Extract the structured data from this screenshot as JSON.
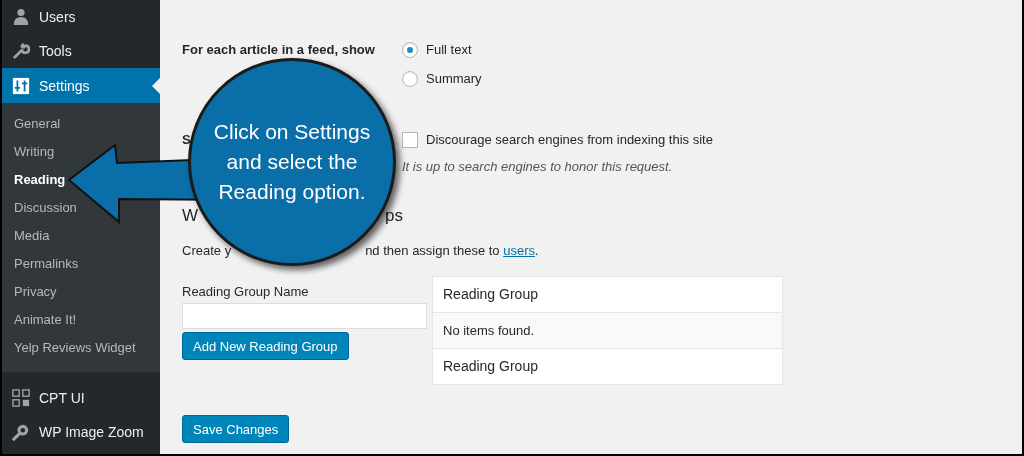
{
  "sidebar": {
    "menu_top": [
      {
        "label": "Users",
        "selected": false
      },
      {
        "label": "Tools",
        "selected": false
      },
      {
        "label": "Settings",
        "selected": true
      }
    ],
    "submenu": [
      {
        "label": "General",
        "selected": false
      },
      {
        "label": "Writing",
        "selected": false
      },
      {
        "label": "Reading",
        "selected": true
      },
      {
        "label": "Discussion",
        "selected": false
      },
      {
        "label": "Media",
        "selected": false
      },
      {
        "label": "Permalinks",
        "selected": false
      },
      {
        "label": "Privacy",
        "selected": false
      },
      {
        "label": "Animate It!",
        "selected": false
      },
      {
        "label": "Yelp Reviews Widget",
        "selected": false
      }
    ],
    "menu_bottom": [
      {
        "label": "CPT UI",
        "selected": false
      },
      {
        "label": "WP Image Zoom",
        "selected": false
      }
    ]
  },
  "feed_setting": {
    "label": "For each article in a feed, show",
    "options": [
      {
        "label": "Full text",
        "selected": true
      },
      {
        "label": "Summary",
        "selected": false
      }
    ]
  },
  "visibility": {
    "label_fragment": "S",
    "checkbox": {
      "label": "Discourage search engines from indexing this site",
      "checked": false
    },
    "note": "It is up to search engines to honor this request."
  },
  "groups_section": {
    "heading_fragments": [
      "W",
      "ps"
    ],
    "description": {
      "start": "Create y",
      "rest": "nd then assign these to ",
      "link": "users",
      "end": "."
    },
    "name_field": {
      "label": "Reading Group Name"
    },
    "add_button": "Add New Reading Group",
    "table": {
      "header": "Reading Group",
      "empty_message": "No items found.",
      "footer": "Reading Group"
    }
  },
  "save_button": "Save Changes",
  "callout": {
    "lines": [
      "Click on Settings",
      "and select the",
      "Reading option."
    ]
  }
}
